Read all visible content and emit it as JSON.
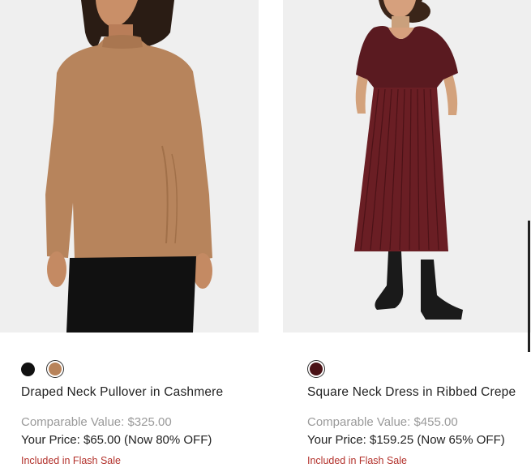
{
  "products": [
    {
      "name": "Draped Neck Pullover in Cashmere",
      "image_alt": "model-wearing-camel-pullover",
      "swatches": [
        {
          "color": "#111111",
          "selected": false
        },
        {
          "color": "#b8835a",
          "selected": true
        }
      ],
      "comparable_value": "Comparable Value: $325.00",
      "your_price": "Your Price: $65.00 (Now 80% OFF)",
      "flash_sale": "Included in Flash Sale"
    },
    {
      "name": "Square Neck Dress in Ribbed Crepe",
      "image_alt": "model-wearing-burgundy-dress",
      "swatches": [
        {
          "color": "#4a1216",
          "selected": true
        }
      ],
      "comparable_value": "Comparable Value: $455.00",
      "your_price": "Your Price: $159.25 (Now 65% OFF)",
      "flash_sale": "Included in Flash Sale"
    }
  ],
  "colors": {
    "image_bg": "#efefef",
    "sale_red": "#b3312b",
    "muted_gray": "#9a9a9a"
  }
}
